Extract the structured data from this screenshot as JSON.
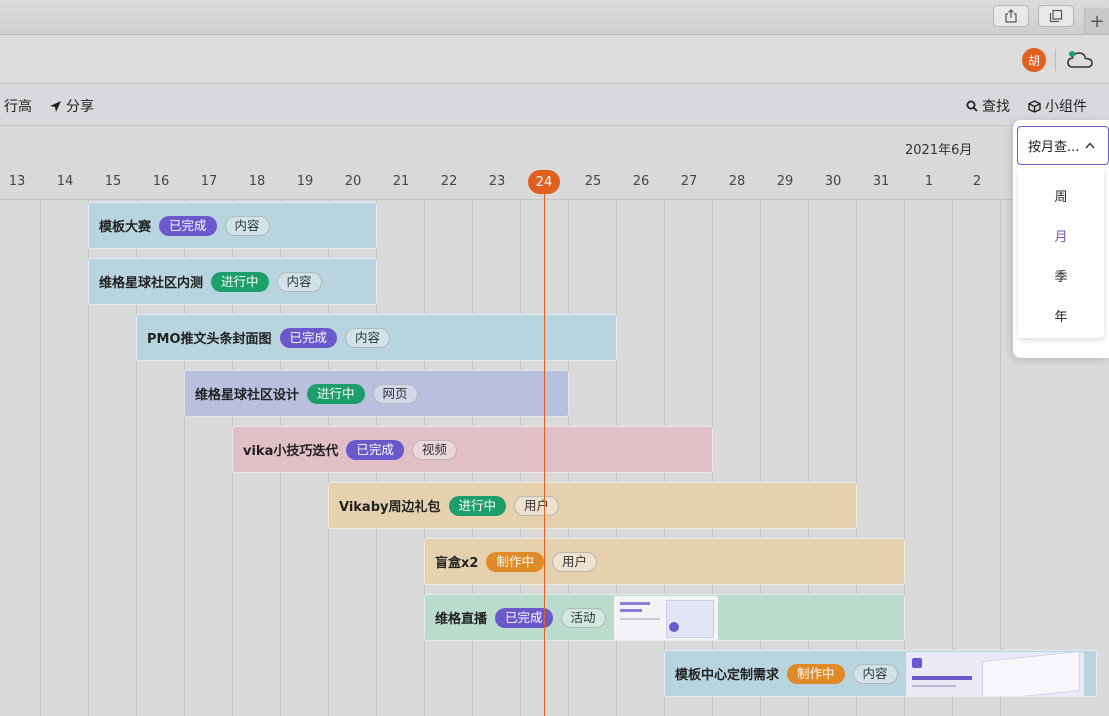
{
  "toolbar": {
    "row_height_label": "行高",
    "share_label": "分享",
    "search_label": "查找",
    "widget_label": "小组件"
  },
  "header": {
    "avatar_text": "胡"
  },
  "timeline": {
    "month": "2021年6月",
    "days": [
      "13",
      "14",
      "15",
      "16",
      "17",
      "18",
      "19",
      "20",
      "21",
      "22",
      "23",
      "24",
      "25",
      "26",
      "27",
      "28",
      "29",
      "30",
      "31",
      "1",
      "2"
    ],
    "today": "24"
  },
  "view_selector": {
    "current": "按月查...",
    "options": [
      "周",
      "月",
      "季",
      "年"
    ],
    "selected": "月"
  },
  "tasks": [
    {
      "name": "模板大赛",
      "status": "已完成",
      "tag": "内容"
    },
    {
      "name": "维格星球社区内测",
      "status": "进行中",
      "tag": "内容"
    },
    {
      "name": "PMO推文头条封面图",
      "status": "已完成",
      "tag": "内容"
    },
    {
      "name": "维格星球社区设计",
      "status": "进行中",
      "tag": "网页"
    },
    {
      "name": "vika小技巧迭代",
      "status": "已完成",
      "tag": "视频"
    },
    {
      "name": "Vikaby周边礼包",
      "status": "进行中",
      "tag": "用户"
    },
    {
      "name": "盲盒x2",
      "status": "制作中",
      "tag": "用户"
    },
    {
      "name": "维格直播",
      "status": "已完成",
      "tag": "活动"
    },
    {
      "name": "模板中心定制需求",
      "status": "制作中",
      "tag": "内容"
    }
  ],
  "colors": {
    "accent": "#6a59cb",
    "today": "#e0601f",
    "done": "#6a59cb",
    "in_progress": "#1d9f6b",
    "making": "#e18a28"
  }
}
